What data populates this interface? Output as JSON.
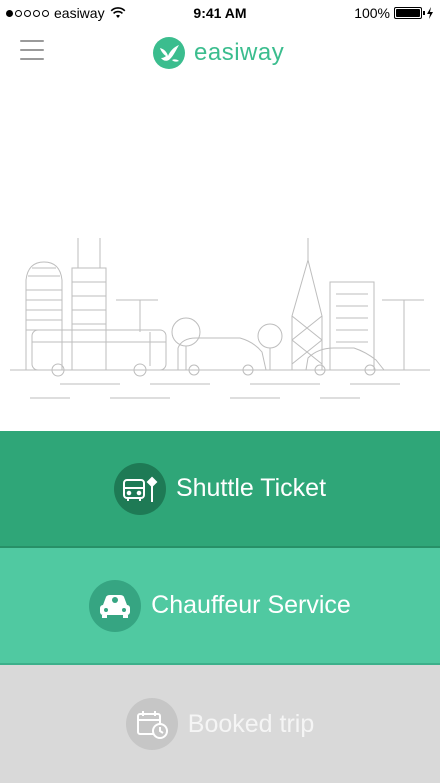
{
  "status_bar": {
    "carrier": "easiway",
    "time": "9:41 AM",
    "battery": "100%"
  },
  "header": {
    "app_name": "easiway",
    "menu_icon": "hamburger-menu-icon",
    "logo_icon": "bird-logo-icon"
  },
  "illustration": {
    "description_icon": "city-skyline-illustration"
  },
  "actions": [
    {
      "label": "Shuttle Ticket",
      "icon": "bus-stop-icon"
    },
    {
      "label": "Chauffeur Service",
      "icon": "car-driver-icon"
    },
    {
      "label": "Booked trip",
      "icon": "calendar-clock-icon"
    }
  ],
  "colors": {
    "brand": "#3bbd8e",
    "shuttle": "#2fa678",
    "chauffeur": "#50c9a1",
    "booked": "#d9d9d9"
  }
}
